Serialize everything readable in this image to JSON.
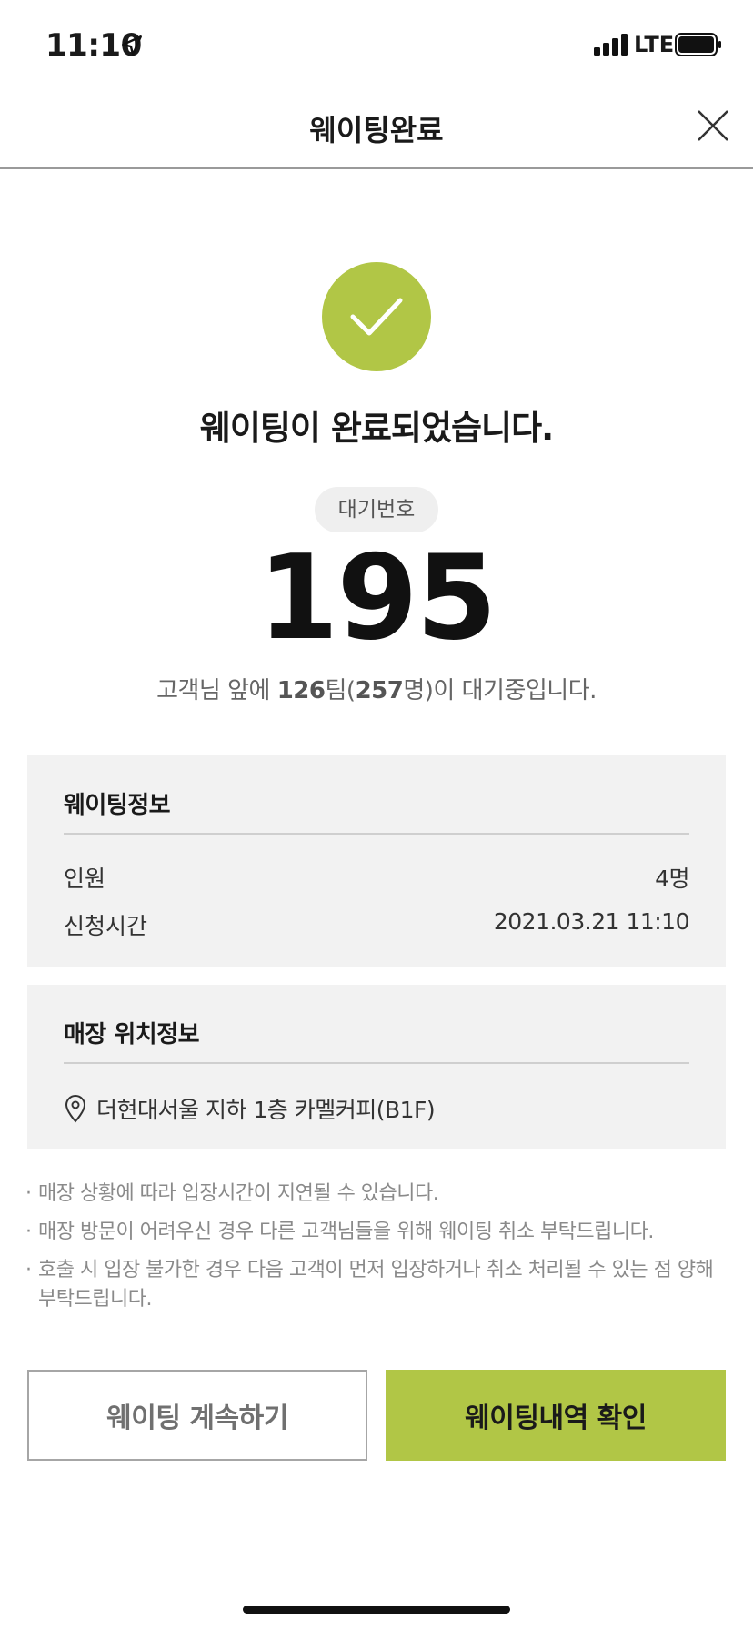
{
  "status_bar": {
    "time": "11:10",
    "network": "LTE"
  },
  "header": {
    "title": "웨이팅완료"
  },
  "success": {
    "message": "웨이팅이 완료되었습니다."
  },
  "queue": {
    "label": "대기번호",
    "number": "195",
    "ahead_prefix": "고객님 앞에 ",
    "teams": "126",
    "teams_unit": "팀(",
    "people": "257",
    "ahead_suffix": "명)이 대기중입니다."
  },
  "waiting_info": {
    "title": "웨이팅정보",
    "rows": [
      {
        "label": "인원",
        "value": "4명"
      },
      {
        "label": "신청시간",
        "value": "2021.03.21 11:10"
      }
    ]
  },
  "location_info": {
    "title": "매장 위치정보",
    "address": "더현대서울 지하 1층 카멜커피(B1F)"
  },
  "notices": [
    "매장 상황에 따라 입장시간이 지연될 수 있습니다.",
    "매장 방문이 어려우신 경우 다른 고객님들을 위해 웨이팅 취소 부탁드립니다.",
    "호출 시 입장 불가한 경우 다음 고객이 먼저 입장하거나 취소 처리될 수 있는 점 양해 부탁드립니다."
  ],
  "buttons": {
    "continue_label": "웨이팅 계속하기",
    "history_label": "웨이팅내역 확인"
  },
  "colors": {
    "accent": "#b1c646",
    "box_bg": "#f2f2f2"
  },
  "icons": [
    "location-arrow-icon",
    "signal-icon",
    "battery-icon",
    "close-icon",
    "check-icon",
    "map-pin-icon"
  ]
}
